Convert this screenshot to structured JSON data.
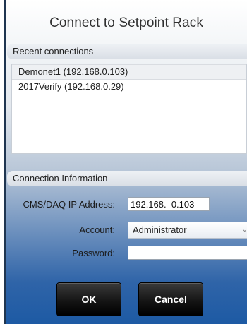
{
  "dialog": {
    "title": "Connect to Setpoint Rack"
  },
  "recent": {
    "header": "Recent connections",
    "items": [
      "Demonet1 (192.168.0.103)",
      "2017Verify (192.168.0.29)"
    ],
    "selected_index": 0
  },
  "connection": {
    "header": "Connection Information",
    "ip_label": "CMS/DAQ IP Address:",
    "ip_value": "192.168.  0.103",
    "account_label": "Account:",
    "account_value": "Administrator",
    "password_label": "Password:",
    "password_value": ""
  },
  "buttons": {
    "ok_label": "OK",
    "cancel_label": "Cancel"
  }
}
